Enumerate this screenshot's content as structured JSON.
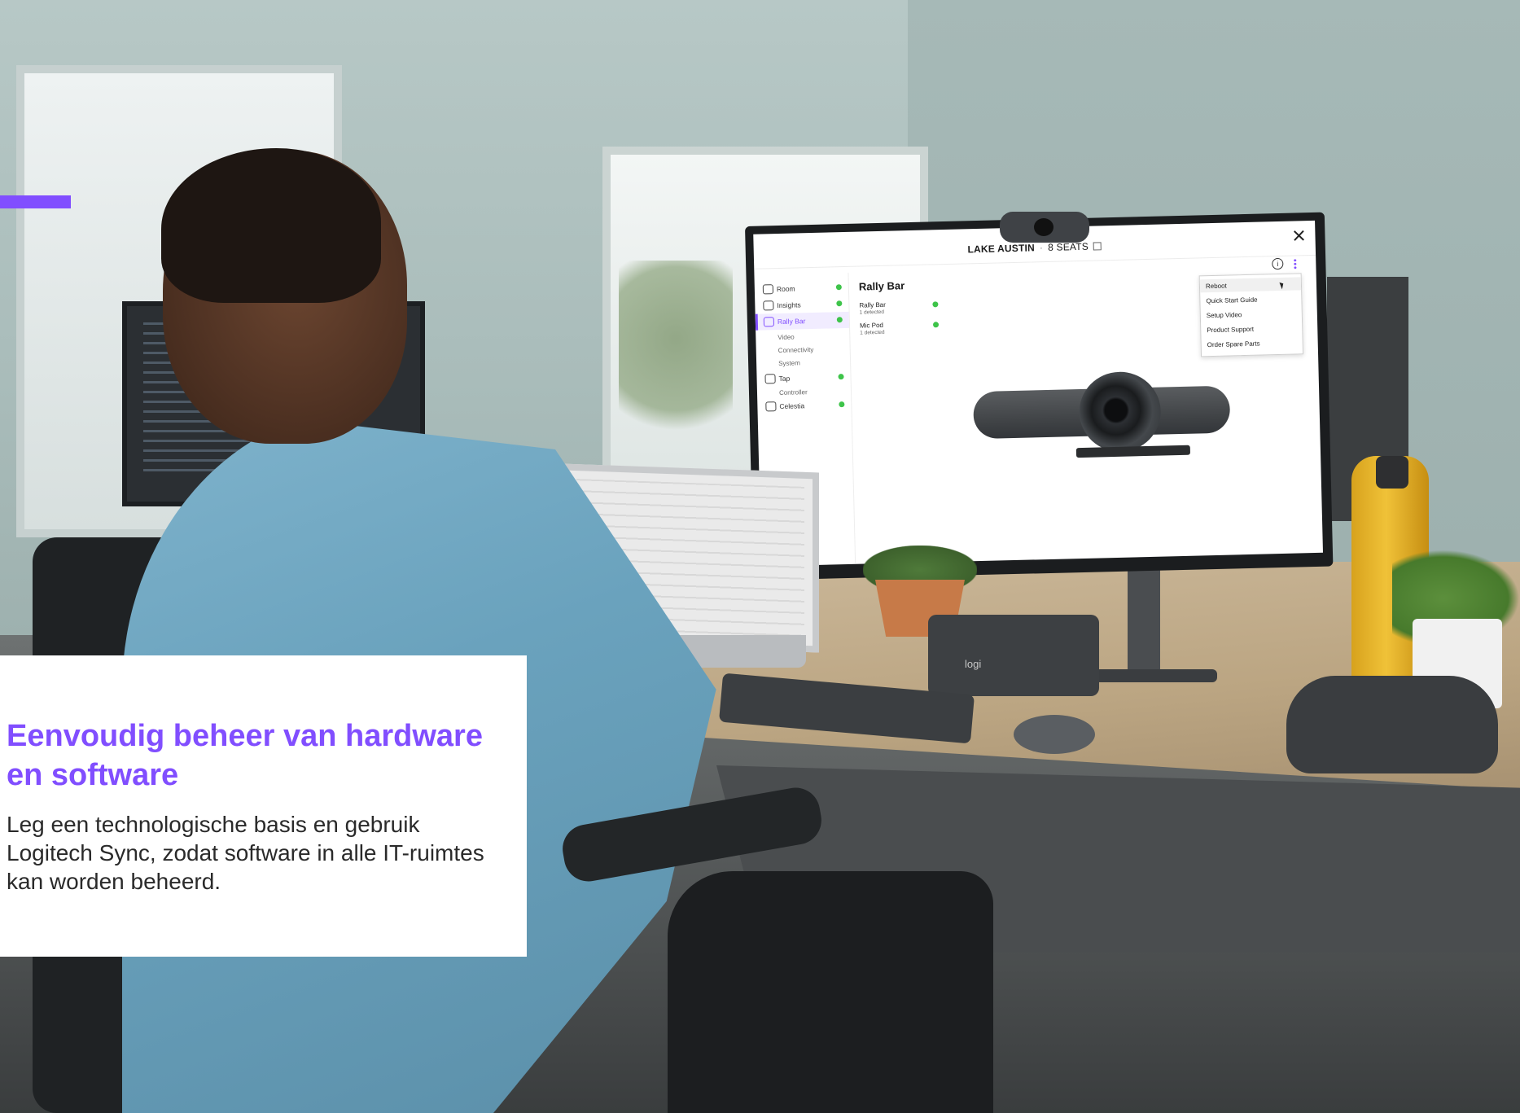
{
  "brand": {
    "accent": "#814eff",
    "status_ok": "#3ec44a"
  },
  "sync_app": {
    "room_name": "LAKE AUSTIN",
    "separator": "·",
    "seats": "8 SEATS",
    "sidebar": [
      {
        "label": "Room",
        "icon": "room-icon",
        "status": "ok"
      },
      {
        "label": "Insights",
        "icon": "lightbulb-icon",
        "status": "ok"
      },
      {
        "label": "Rally Bar",
        "icon": "camera-bar-icon",
        "status": "ok",
        "active": true
      },
      {
        "label": "Tap",
        "icon": "tablet-icon",
        "status": "ok"
      },
      {
        "label": "Celestia",
        "icon": "speaker-icon",
        "status": "ok"
      }
    ],
    "sidebar_sub": {
      "video": "Video",
      "connectivity": "Connectivity",
      "system": "System",
      "controller": "Controller"
    },
    "content": {
      "title": "Rally Bar",
      "devices": [
        {
          "name": "Rally Bar",
          "status": "1 detected"
        },
        {
          "name": "Mic Pod",
          "status": "1 detected"
        }
      ]
    },
    "menu": [
      "Reboot",
      "Quick Start Guide",
      "Setup Video",
      "Product Support",
      "Order Spare Parts"
    ]
  },
  "speaker_brand": "logi",
  "card": {
    "headline": "Eenvoudig beheer van hardware en software",
    "body": "Leg een technologische basis en gebruik Logitech Sync, zodat software in alle IT-ruimtes kan worden beheerd."
  }
}
